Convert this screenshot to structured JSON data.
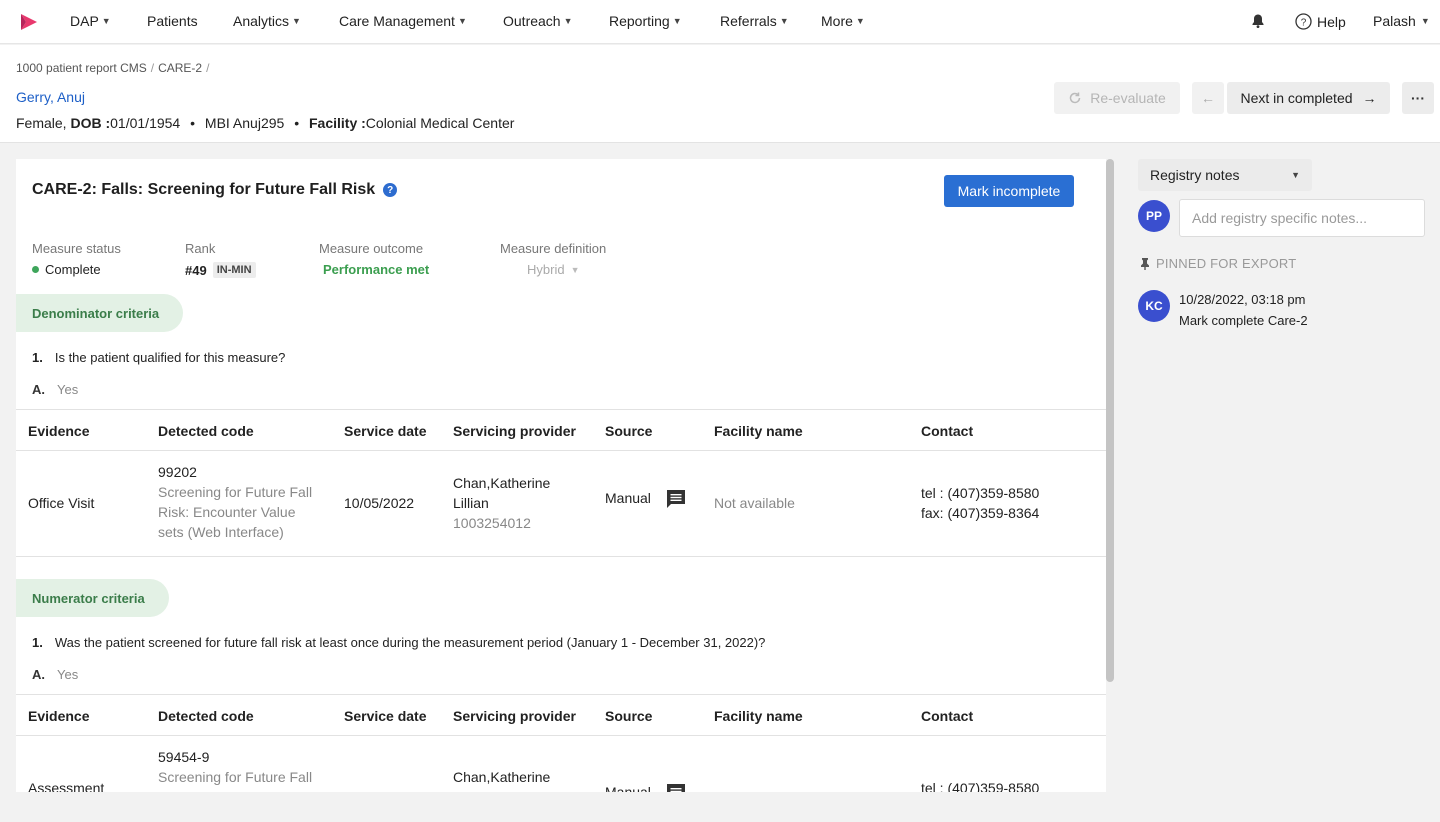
{
  "nav": {
    "items": [
      {
        "label": "DAP",
        "dropdown": true
      },
      {
        "label": "Patients",
        "dropdown": false
      },
      {
        "label": "Analytics",
        "dropdown": true
      },
      {
        "label": "Care Management",
        "dropdown": true
      },
      {
        "label": "Outreach",
        "dropdown": true
      },
      {
        "label": "Reporting",
        "dropdown": true
      },
      {
        "label": "Referrals",
        "dropdown": true
      },
      {
        "label": "More",
        "dropdown": true
      }
    ],
    "help_label": "Help",
    "user_label": "Palash",
    "chevron": "⌄"
  },
  "breadcrumb": {
    "items": [
      "1000 patient report CMS",
      "CARE-2"
    ],
    "separator": "/"
  },
  "patient": {
    "name": "Gerry, Anuj",
    "gender": "Female,",
    "dob_label": "DOB :",
    "dob": "01/01/1954",
    "mbi_label": "MBI",
    "mbi": "Anuj295",
    "facility_label": "Facility :",
    "facility": "Colonial Medical Center",
    "bullet": "•"
  },
  "toolbar": {
    "reevaluate_label": "Re-evaluate",
    "next_label": "Next in completed",
    "more_label": "···"
  },
  "measure": {
    "title": "CARE-2: Falls: Screening for Future Fall Risk",
    "help_glyph": "?",
    "mark_incomplete_label": "Mark incomplete",
    "status_label": "Measure status",
    "status_value": "Complete",
    "rank_label": "Rank",
    "rank_value": "#49",
    "rank_badge": "IN-MIN",
    "outcome_label": "Measure outcome",
    "outcome_value": "Performance met",
    "definition_label": "Measure definition",
    "definition_value": "Hybrid"
  },
  "table_headers": [
    "Evidence",
    "Detected code",
    "Service date",
    "Servicing provider",
    "Source",
    "Facility name",
    "Contact"
  ],
  "denominator": {
    "pill": "Denominator criteria",
    "q_num": "1.",
    "question": "Is the patient qualified for this measure?",
    "a_label": "A.",
    "answer": "Yes",
    "row": {
      "evidence": "Office Visit",
      "code": "99202",
      "code_desc_1": "Screening for Future Fall",
      "code_desc_2": "Risk: Encounter Value",
      "code_desc_3": "sets (Web Interface)",
      "service_date": "10/05/2022",
      "provider_1": "Chan,Katherine",
      "provider_2": "Lillian",
      "provider_id": "1003254012",
      "source": "Manual",
      "facility": "Not available",
      "tel": "tel : (407)359-8580",
      "fax": "fax: (407)359-8364"
    }
  },
  "numerator": {
    "pill": "Numerator criteria",
    "q_num": "1.",
    "question": "Was the patient screened for future fall risk at least once during the measurement period (January 1 - December 31, 2022)?",
    "a_label": "A.",
    "answer": "Yes",
    "row": {
      "evidence": "Assessment",
      "code": "59454-9",
      "code_desc_1": "Screening for Future Fall",
      "provider_1": "Chan,Katherine",
      "source": "Manual",
      "tel": "tel : (407)359-8580"
    }
  },
  "notes": {
    "dropdown_label": "Registry notes",
    "avatar_initials": "PP",
    "input_placeholder": "Add registry specific notes...",
    "pinned_label": "PINNED FOR EXPORT",
    "note_avatar": "KC",
    "note_time": "10/28/2022, 03:18 pm",
    "note_text": "Mark complete Care-2"
  },
  "colors": {
    "accent": "#2a6fd3",
    "link": "#1d5fc7",
    "success": "#3ea55b",
    "pill_bg": "#e3f1e5",
    "avatar": "#3a4fcf"
  }
}
